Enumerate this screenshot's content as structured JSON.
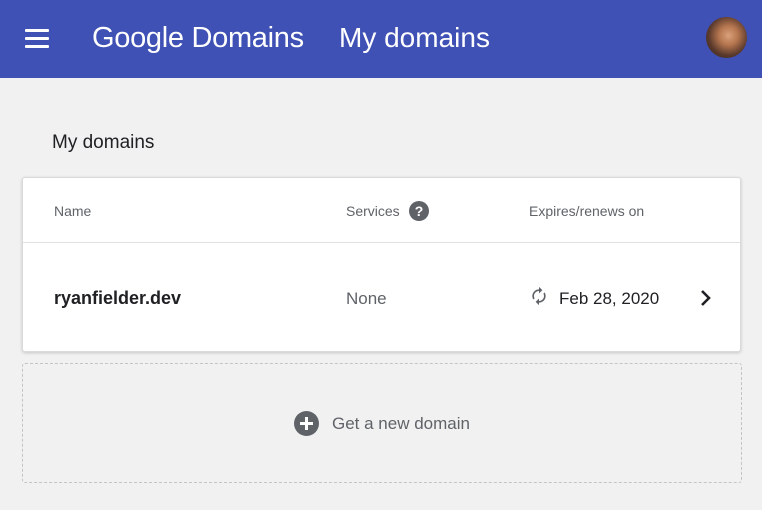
{
  "header": {
    "menu_icon": "hamburger-menu-icon",
    "brand": "Google Domains",
    "title": "My domains",
    "avatar_icon": "user-avatar"
  },
  "main": {
    "section_title": "My domains",
    "table": {
      "columns": [
        "Name",
        "Services",
        "Expires/renews on"
      ],
      "help_icon": "help-icon",
      "help_glyph": "?",
      "rows": [
        {
          "name": "ryanfielder.dev",
          "services": "None",
          "expires": "Feb 28, 2020",
          "renew_icon": "auto-renew-icon",
          "open_icon": "chevron-right-icon"
        }
      ]
    },
    "add_domain": {
      "icon": "add-circle-icon",
      "label": "Get a new domain"
    }
  },
  "colors": {
    "app_bar": "#3f51b5",
    "page_background": "#f1f1f1",
    "card_background": "#ffffff"
  }
}
